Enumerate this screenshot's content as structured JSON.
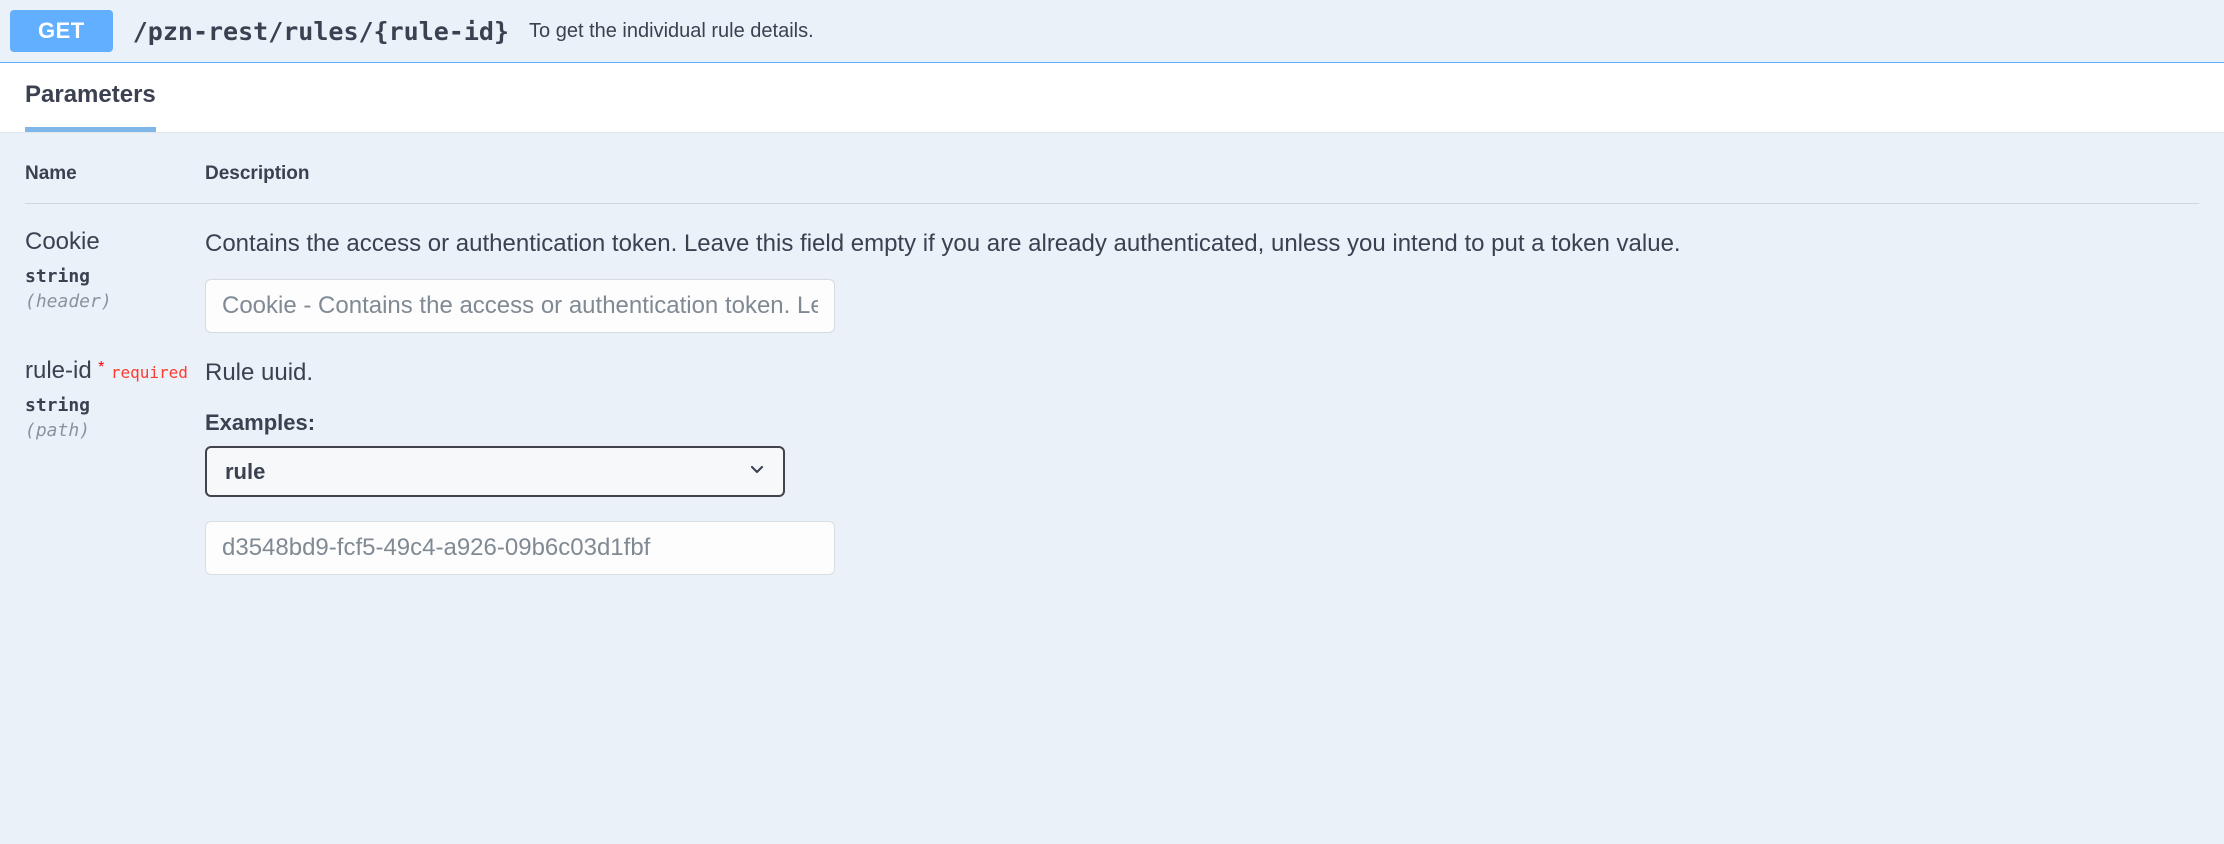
{
  "header": {
    "method": "GET",
    "path": "/pzn-rest/rules/{rule-id}",
    "summary": "To get the individual rule details."
  },
  "tabs": {
    "parameters": "Parameters"
  },
  "tableHeaders": {
    "name": "Name",
    "description": "Description"
  },
  "params": [
    {
      "name": "Cookie",
      "type": "string",
      "in": "(header)",
      "required": false,
      "description": "Contains the access or authentication token. Leave this field empty if you are already authenticated, unless you intend to put a token value.",
      "placeholder": "Cookie - Contains the access or authentication token. Leave this field empty if you are already authenticated, unless you intend to put a token value."
    },
    {
      "name": "rule-id",
      "type": "string",
      "in": "(path)",
      "required": true,
      "requiredLabel": "required",
      "description": "Rule uuid.",
      "examplesLabel": "Examples:",
      "exampleSelected": "rule",
      "exampleValue": "d3548bd9-fcf5-49c4-a926-09b6c03d1fbf"
    }
  ]
}
